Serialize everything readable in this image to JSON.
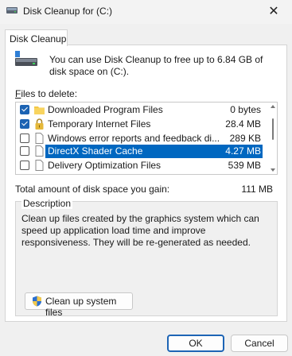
{
  "window": {
    "title": "Disk Cleanup for  (C:)",
    "close_glyph": "✕"
  },
  "tab": {
    "label": "Disk Cleanup"
  },
  "intro": {
    "text": "You can use Disk Cleanup to free up to 6.84 GB of disk space on  (C:)."
  },
  "files": {
    "label_prefix": "F",
    "label_rest": "iles to delete:",
    "items": [
      {
        "name": "Downloaded Program Files",
        "size": "0 bytes",
        "checked": true,
        "icon": "folder-icon"
      },
      {
        "name": "Temporary Internet Files",
        "size": "28.4 MB",
        "checked": true,
        "icon": "lock-icon"
      },
      {
        "name": "Windows error reports and feedback di...",
        "size": "289 KB",
        "checked": false,
        "icon": "file-icon"
      },
      {
        "name": "DirectX Shader Cache",
        "size": "4.27 MB",
        "checked": false,
        "icon": "file-icon",
        "selected": true
      },
      {
        "name": "Delivery Optimization Files",
        "size": "539 MB",
        "checked": false,
        "icon": "file-icon"
      }
    ]
  },
  "total": {
    "label": "Total amount of disk space you gain:",
    "value": "111 MB"
  },
  "description": {
    "title": "Description",
    "text": "Clean up files created by the graphics system which can speed up application load time and improve responsiveness. They will be re-generated as needed."
  },
  "buttons": {
    "cleanup": "Clean up system files",
    "ok": "OK",
    "cancel": "Cancel"
  },
  "colors": {
    "accent": "#0067c0",
    "checkbox": "#1c63b3"
  }
}
